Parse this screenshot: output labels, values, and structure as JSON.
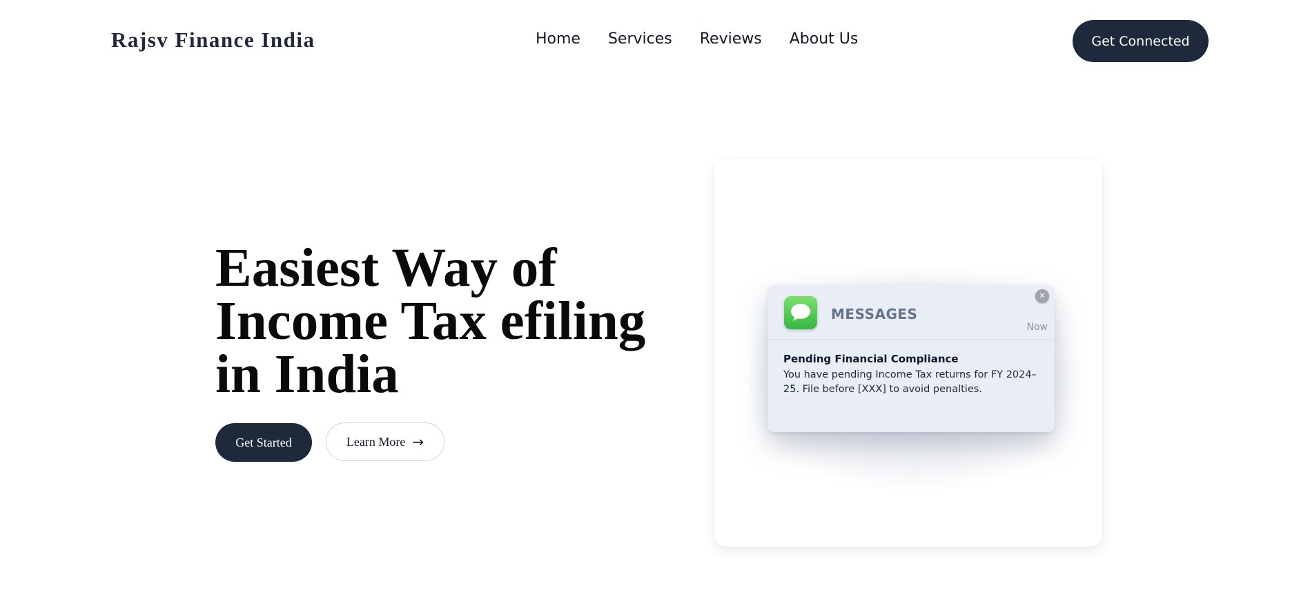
{
  "header": {
    "brand": "Rajsv Finance India",
    "nav": [
      "Home",
      "Services",
      "Reviews",
      "About Us"
    ],
    "cta_label": "Get Connected"
  },
  "hero": {
    "title": "Easiest Way of Income Tax efiling in India",
    "primary_button": "Get Started",
    "secondary_button": "Learn More",
    "secondary_arrow": "→"
  },
  "notification": {
    "app_name": "MESSAGES",
    "time": "Now",
    "title": "Pending Financial Compliance",
    "body": "You have pending Income Tax returns for FY 2024–25. File before [XXX] to avoid penalties.",
    "close_glyph": "✕",
    "icon": "messages-app-icon",
    "close_icon": "close-icon"
  },
  "colors": {
    "primary": "#1e293b",
    "message_green": "#35b842",
    "notification_bg": "#e9eef6"
  }
}
